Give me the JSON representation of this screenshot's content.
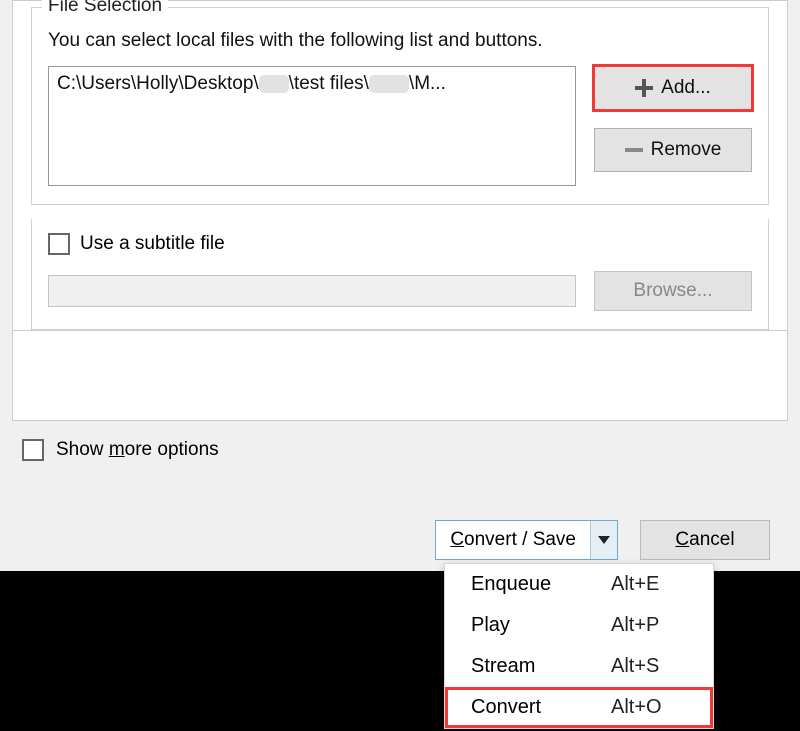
{
  "file_selection": {
    "title": "File Selection",
    "hint": "You can select local files with the following list and buttons.",
    "file_path_prefix": "C:\\Users\\Holly\\Desktop\\",
    "file_path_mid": "\\test files\\",
    "file_path_suffix": "\\M...",
    "add_label": "Add...",
    "remove_label": "Remove"
  },
  "subtitle": {
    "checkbox_label": "Use a subtitle file",
    "browse_label": "Browse..."
  },
  "show_more_label_pre": "Show ",
  "show_more_label_u": "m",
  "show_more_label_post": "ore options",
  "convert_save": {
    "label_u": "C",
    "label_rest": "onvert / Save"
  },
  "cancel": {
    "label_u": "C",
    "label_rest": "ancel"
  },
  "menu": {
    "items": [
      {
        "label": "Enqueue",
        "shortcut": "Alt+E"
      },
      {
        "label": "Play",
        "shortcut": "Alt+P"
      },
      {
        "label": "Stream",
        "shortcut": "Alt+S"
      },
      {
        "label": "Convert",
        "shortcut": "Alt+O"
      }
    ]
  }
}
